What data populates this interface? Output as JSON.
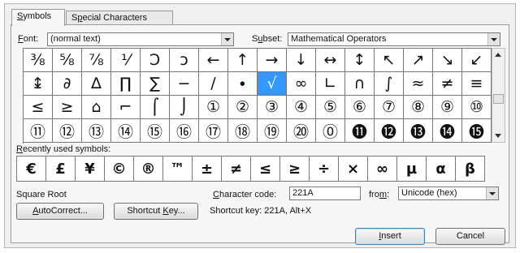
{
  "tabs": [
    {
      "label": "Symbols",
      "mnemonic": "S",
      "rest": "ymbols"
    },
    {
      "label": "Special Characters",
      "pre": "S",
      "mnemonic": "p",
      "rest": "ecial Characters"
    }
  ],
  "font": {
    "label": "Font:",
    "mnemonic": "F",
    "rest": "ont:",
    "value": "(normal text)"
  },
  "subset": {
    "label": "Subset:",
    "pre": "S",
    "mnemonic": "u",
    "rest": "bset:",
    "value": "Mathematical Operators"
  },
  "symbols": [
    "⅜",
    "⅝",
    "⅞",
    "⅟",
    "Ↄ",
    "ↄ",
    "←",
    "↑",
    "→",
    "↓",
    "↔",
    "↕",
    "↖",
    "↗",
    "↘",
    "↙",
    "↨",
    "∂",
    "∆",
    "∏",
    "∑",
    "−",
    "∕",
    "∙",
    "√",
    "∞",
    "∟",
    "∩",
    "∫",
    "≈",
    "≠",
    "≡",
    "≤",
    "≥",
    "⌂",
    "⌐",
    "⌠",
    "⌡",
    "①",
    "②",
    "③",
    "④",
    "⑤",
    "⑥",
    "⑦",
    "⑧",
    "⑨",
    "⑩",
    "⑪",
    "⑫",
    "⑬",
    "⑭",
    "⑮",
    "⑯",
    "⑰",
    "⑱",
    "⑲",
    "⑳",
    "⓪",
    "⓫",
    "⓬",
    "⓭",
    "⓮",
    "⓯"
  ],
  "selected_index": 24,
  "recent": {
    "label": "Recently used symbols:",
    "mnemonic": "R",
    "rest": "ecently used symbols:",
    "symbols": [
      "€",
      "£",
      "¥",
      "©",
      "®",
      "™",
      "±",
      "≠",
      "≤",
      "≥",
      "÷",
      "×",
      "∞",
      "µ",
      "α",
      "β"
    ]
  },
  "char_name": "Square Root",
  "char_code": {
    "label": "Character code:",
    "pre": "",
    "mnemonic": "C",
    "rest": "haracter code:",
    "value": "221A"
  },
  "from": {
    "label": "from:",
    "pre": "fro",
    "mnemonic": "m",
    "rest": ":",
    "value": "Unicode (hex)"
  },
  "buttons": {
    "autocorrect": {
      "mnemonic": "A",
      "rest": "utoCorrect..."
    },
    "shortcut": {
      "pre": "Shortcut ",
      "mnemonic": "K",
      "rest": "ey..."
    },
    "insert": {
      "mnemonic": "I",
      "rest": "nsert"
    },
    "cancel": "Cancel"
  },
  "shortcut_text": "Shortcut key: 221A, Alt+X"
}
